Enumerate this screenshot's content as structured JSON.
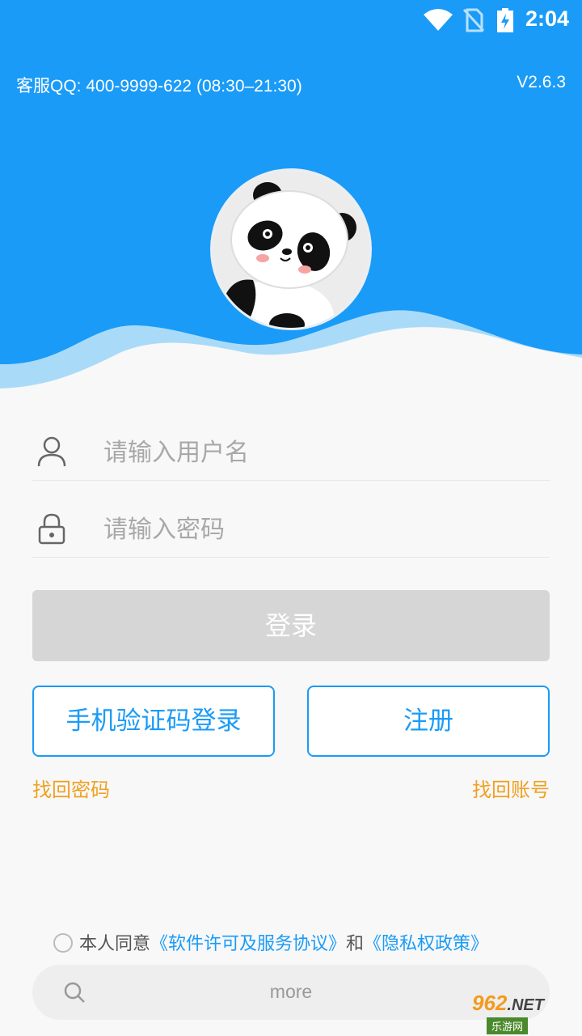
{
  "statusbar": {
    "time": "2:04"
  },
  "header": {
    "service_qq": "客服QQ: 400-9999-622 (08:30–21:30)",
    "version": "V2.6.3",
    "colors": {
      "primary": "#1a9bf7"
    }
  },
  "form": {
    "username_placeholder": "请输入用户名",
    "password_placeholder": "请输入密码",
    "login_label": "登录",
    "sms_login_label": "手机验证码登录",
    "register_label": "注册",
    "recover_password": "找回密码",
    "recover_account": "找回账号"
  },
  "agreement": {
    "prefix": "本人同意",
    "license_link": "《软件许可及服务协议》",
    "conjunction": "和",
    "privacy_link": "《隐私权政策》"
  },
  "more_bar": {
    "label": "more"
  },
  "watermark": {
    "top": "962",
    "suffix": ".NET",
    "bottom": "乐游网"
  }
}
